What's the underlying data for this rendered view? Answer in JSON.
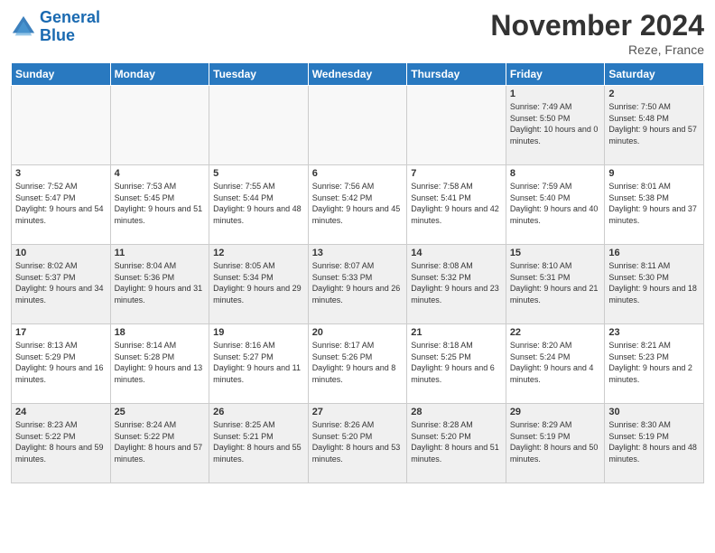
{
  "logo": {
    "line1": "General",
    "line2": "Blue"
  },
  "title": "November 2024",
  "location": "Reze, France",
  "days_header": [
    "Sunday",
    "Monday",
    "Tuesday",
    "Wednesday",
    "Thursday",
    "Friday",
    "Saturday"
  ],
  "weeks": [
    [
      {
        "day": "",
        "sunrise": "",
        "sunset": "",
        "daylight": ""
      },
      {
        "day": "",
        "sunrise": "",
        "sunset": "",
        "daylight": ""
      },
      {
        "day": "",
        "sunrise": "",
        "sunset": "",
        "daylight": ""
      },
      {
        "day": "",
        "sunrise": "",
        "sunset": "",
        "daylight": ""
      },
      {
        "day": "",
        "sunrise": "",
        "sunset": "",
        "daylight": ""
      },
      {
        "day": "1",
        "sunrise": "Sunrise: 7:49 AM",
        "sunset": "Sunset: 5:50 PM",
        "daylight": "Daylight: 10 hours and 0 minutes."
      },
      {
        "day": "2",
        "sunrise": "Sunrise: 7:50 AM",
        "sunset": "Sunset: 5:48 PM",
        "daylight": "Daylight: 9 hours and 57 minutes."
      }
    ],
    [
      {
        "day": "3",
        "sunrise": "Sunrise: 7:52 AM",
        "sunset": "Sunset: 5:47 PM",
        "daylight": "Daylight: 9 hours and 54 minutes."
      },
      {
        "day": "4",
        "sunrise": "Sunrise: 7:53 AM",
        "sunset": "Sunset: 5:45 PM",
        "daylight": "Daylight: 9 hours and 51 minutes."
      },
      {
        "day": "5",
        "sunrise": "Sunrise: 7:55 AM",
        "sunset": "Sunset: 5:44 PM",
        "daylight": "Daylight: 9 hours and 48 minutes."
      },
      {
        "day": "6",
        "sunrise": "Sunrise: 7:56 AM",
        "sunset": "Sunset: 5:42 PM",
        "daylight": "Daylight: 9 hours and 45 minutes."
      },
      {
        "day": "7",
        "sunrise": "Sunrise: 7:58 AM",
        "sunset": "Sunset: 5:41 PM",
        "daylight": "Daylight: 9 hours and 42 minutes."
      },
      {
        "day": "8",
        "sunrise": "Sunrise: 7:59 AM",
        "sunset": "Sunset: 5:40 PM",
        "daylight": "Daylight: 9 hours and 40 minutes."
      },
      {
        "day": "9",
        "sunrise": "Sunrise: 8:01 AM",
        "sunset": "Sunset: 5:38 PM",
        "daylight": "Daylight: 9 hours and 37 minutes."
      }
    ],
    [
      {
        "day": "10",
        "sunrise": "Sunrise: 8:02 AM",
        "sunset": "Sunset: 5:37 PM",
        "daylight": "Daylight: 9 hours and 34 minutes."
      },
      {
        "day": "11",
        "sunrise": "Sunrise: 8:04 AM",
        "sunset": "Sunset: 5:36 PM",
        "daylight": "Daylight: 9 hours and 31 minutes."
      },
      {
        "day": "12",
        "sunrise": "Sunrise: 8:05 AM",
        "sunset": "Sunset: 5:34 PM",
        "daylight": "Daylight: 9 hours and 29 minutes."
      },
      {
        "day": "13",
        "sunrise": "Sunrise: 8:07 AM",
        "sunset": "Sunset: 5:33 PM",
        "daylight": "Daylight: 9 hours and 26 minutes."
      },
      {
        "day": "14",
        "sunrise": "Sunrise: 8:08 AM",
        "sunset": "Sunset: 5:32 PM",
        "daylight": "Daylight: 9 hours and 23 minutes."
      },
      {
        "day": "15",
        "sunrise": "Sunrise: 8:10 AM",
        "sunset": "Sunset: 5:31 PM",
        "daylight": "Daylight: 9 hours and 21 minutes."
      },
      {
        "day": "16",
        "sunrise": "Sunrise: 8:11 AM",
        "sunset": "Sunset: 5:30 PM",
        "daylight": "Daylight: 9 hours and 18 minutes."
      }
    ],
    [
      {
        "day": "17",
        "sunrise": "Sunrise: 8:13 AM",
        "sunset": "Sunset: 5:29 PM",
        "daylight": "Daylight: 9 hours and 16 minutes."
      },
      {
        "day": "18",
        "sunrise": "Sunrise: 8:14 AM",
        "sunset": "Sunset: 5:28 PM",
        "daylight": "Daylight: 9 hours and 13 minutes."
      },
      {
        "day": "19",
        "sunrise": "Sunrise: 8:16 AM",
        "sunset": "Sunset: 5:27 PM",
        "daylight": "Daylight: 9 hours and 11 minutes."
      },
      {
        "day": "20",
        "sunrise": "Sunrise: 8:17 AM",
        "sunset": "Sunset: 5:26 PM",
        "daylight": "Daylight: 9 hours and 8 minutes."
      },
      {
        "day": "21",
        "sunrise": "Sunrise: 8:18 AM",
        "sunset": "Sunset: 5:25 PM",
        "daylight": "Daylight: 9 hours and 6 minutes."
      },
      {
        "day": "22",
        "sunrise": "Sunrise: 8:20 AM",
        "sunset": "Sunset: 5:24 PM",
        "daylight": "Daylight: 9 hours and 4 minutes."
      },
      {
        "day": "23",
        "sunrise": "Sunrise: 8:21 AM",
        "sunset": "Sunset: 5:23 PM",
        "daylight": "Daylight: 9 hours and 2 minutes."
      }
    ],
    [
      {
        "day": "24",
        "sunrise": "Sunrise: 8:23 AM",
        "sunset": "Sunset: 5:22 PM",
        "daylight": "Daylight: 8 hours and 59 minutes."
      },
      {
        "day": "25",
        "sunrise": "Sunrise: 8:24 AM",
        "sunset": "Sunset: 5:22 PM",
        "daylight": "Daylight: 8 hours and 57 minutes."
      },
      {
        "day": "26",
        "sunrise": "Sunrise: 8:25 AM",
        "sunset": "Sunset: 5:21 PM",
        "daylight": "Daylight: 8 hours and 55 minutes."
      },
      {
        "day": "27",
        "sunrise": "Sunrise: 8:26 AM",
        "sunset": "Sunset: 5:20 PM",
        "daylight": "Daylight: 8 hours and 53 minutes."
      },
      {
        "day": "28",
        "sunrise": "Sunrise: 8:28 AM",
        "sunset": "Sunset: 5:20 PM",
        "daylight": "Daylight: 8 hours and 51 minutes."
      },
      {
        "day": "29",
        "sunrise": "Sunrise: 8:29 AM",
        "sunset": "Sunset: 5:19 PM",
        "daylight": "Daylight: 8 hours and 50 minutes."
      },
      {
        "day": "30",
        "sunrise": "Sunrise: 8:30 AM",
        "sunset": "Sunset: 5:19 PM",
        "daylight": "Daylight: 8 hours and 48 minutes."
      }
    ]
  ]
}
